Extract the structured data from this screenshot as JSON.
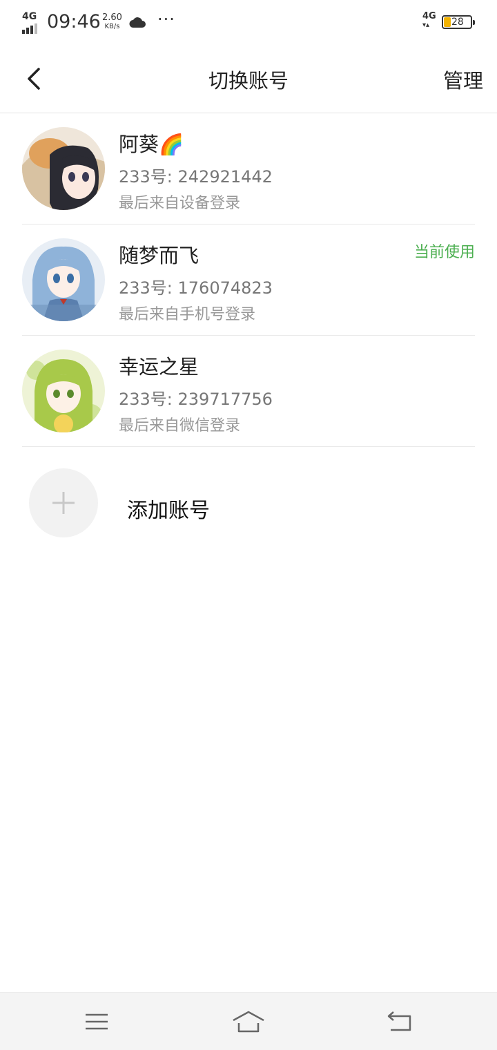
{
  "status_bar": {
    "network_left": "4G",
    "time": "09:46",
    "speed_value": "2.60",
    "speed_unit": "KB/s",
    "more": "···",
    "network_right": "4G",
    "battery_level": "28",
    "battery_color": "#f2b200"
  },
  "header": {
    "title": "切换账号",
    "manage_label": "管理",
    "back_icon": "chevron-left-icon"
  },
  "accounts": [
    {
      "name": "阿葵🌈",
      "id_text": "233号: 242921442",
      "login_text": "最后来自设备登录",
      "current": ""
    },
    {
      "name": "随梦而飞",
      "id_text": "233号: 176074823",
      "login_text": "最后来自手机号登录",
      "current": "当前使用"
    },
    {
      "name": "幸运之星",
      "id_text": "233号: 239717756",
      "login_text": "最后来自微信登录",
      "current": ""
    }
  ],
  "add_account": {
    "label": "添加账号",
    "icon": "plus-icon"
  },
  "nav_bar": {
    "menu_icon": "menu-icon",
    "home_icon": "home-icon",
    "back_icon": "back-arrow-icon"
  },
  "colors": {
    "current_badge": "#4caf50",
    "divider": "#e9e9e9"
  }
}
